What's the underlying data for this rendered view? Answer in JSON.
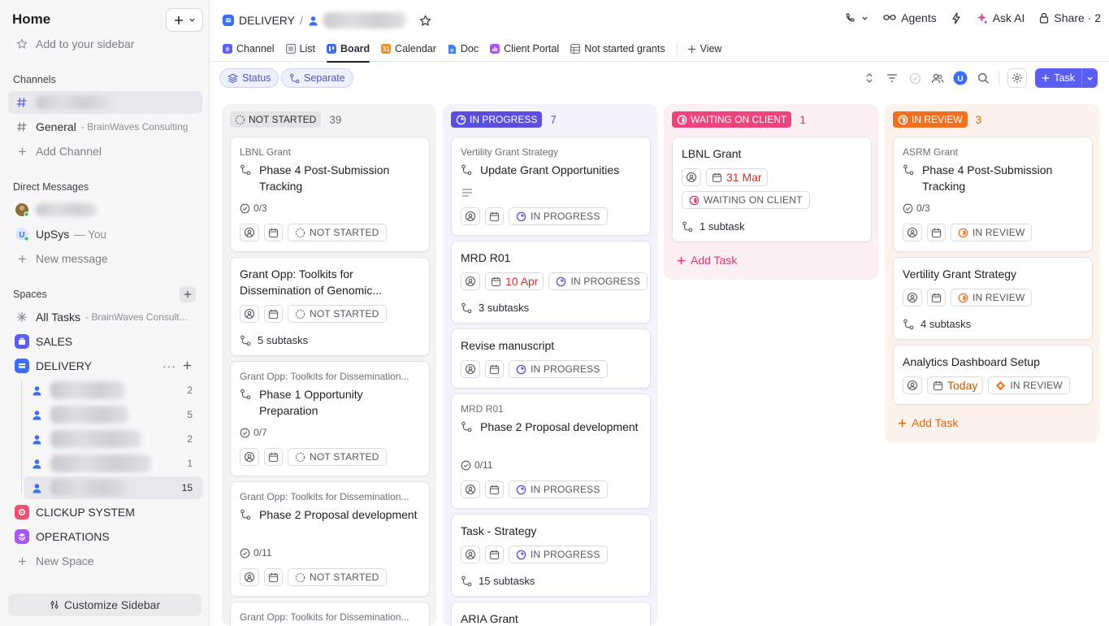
{
  "sidebar": {
    "home": "Home",
    "add_to_sidebar": "Add to your sidebar",
    "channels_title": "Channels",
    "channel_general": "General",
    "channel_general_sub": "- BrainWaves Consulting",
    "add_channel": "Add Channel",
    "dm_title": "Direct Messages",
    "dm_user": "UpSys",
    "dm_user_sub": "— You",
    "new_message": "New message",
    "spaces_title": "Spaces",
    "all_tasks": "All Tasks",
    "all_tasks_sub": "- BrainWaves Consult...",
    "space_sales": "SALES",
    "space_delivery": "DELIVERY",
    "delivery_children_counts": [
      "2",
      "5",
      "2",
      "1",
      "15"
    ],
    "space_clickup": "CLICKUP SYSTEM",
    "space_operations": "OPERATIONS",
    "new_space": "New Space",
    "customize": "Customize Sidebar"
  },
  "header": {
    "breadcrumb_space": "DELIVERY",
    "breadcrumb_sep": "/",
    "agents": "Agents",
    "ask_ai": "Ask AI",
    "share": "Share · 2",
    "views": [
      {
        "label": "Channel",
        "icon": "hash-icon",
        "color": "#5b5ef0"
      },
      {
        "label": "List",
        "icon": "list-icon",
        "color": "#6b6f76"
      },
      {
        "label": "Board",
        "icon": "board-icon",
        "color": "#3b6ef5"
      },
      {
        "label": "Calendar",
        "icon": "calendar-icon",
        "color": "#f08a24"
      },
      {
        "label": "Doc",
        "icon": "doc-icon",
        "color": "#3b82f6"
      },
      {
        "label": "Client Portal",
        "icon": "chart-icon",
        "color": "#a855f7"
      },
      {
        "label": "Not started grants",
        "icon": "table-icon",
        "color": "#6b6f76"
      }
    ],
    "add_view": "View"
  },
  "toolbar": {
    "status": "Status",
    "separate": "Separate",
    "task": "Task"
  },
  "columns": [
    {
      "status": "NOT STARTED",
      "count": "39",
      "color": "#6b6f76",
      "bg": "#f4f4f5"
    },
    {
      "status": "IN PROGRESS",
      "count": "7",
      "color": "#5b4fe0",
      "bg": "#f3f2fd"
    },
    {
      "status": "WAITING ON CLIENT",
      "count": "1",
      "color": "#e0336e",
      "bg": "#fdf0f4",
      "add": "Add Task"
    },
    {
      "status": "IN REVIEW",
      "count": "3",
      "color": "#e8630a",
      "bg": "#fef3ec",
      "add": "Add Task"
    }
  ],
  "cards": {
    "ns1": {
      "parent": "LBNL Grant",
      "title": "Phase 4 Post-Submission Tracking",
      "progress": "0/3",
      "status": "NOT STARTED"
    },
    "ns2": {
      "title": "Grant Opp: Toolkits for Dissemination of Genomic...",
      "status": "NOT STARTED",
      "subtasks": "5 subtasks"
    },
    "ns3": {
      "parent": "Grant Opp: Toolkits for Dissemination...",
      "title": "Phase 1 Opportunity Preparation",
      "progress": "0/7",
      "status": "NOT STARTED"
    },
    "ns4": {
      "parent": "Grant Opp: Toolkits for Dissemination...",
      "title": "Phase 2 Proposal development",
      "progress": "0/11",
      "status": "NOT STARTED"
    },
    "ns5": {
      "parent": "Grant Opp: Toolkits for Dissemination..."
    },
    "ip1": {
      "parent": "Vertility Grant Strategy",
      "title": "Update Grant Opportunities",
      "status": "IN PROGRESS"
    },
    "ip2": {
      "title": "MRD R01",
      "date": "10 Apr",
      "status": "IN PROGRESS",
      "subtasks": "3 subtasks"
    },
    "ip3": {
      "title": "Revise manuscript",
      "status": "IN PROGRESS"
    },
    "ip4": {
      "parent": "MRD R01",
      "title": "Phase 2 Proposal development",
      "progress": "0/11",
      "status": "IN PROGRESS"
    },
    "ip5": {
      "title": "Task - Strategy",
      "status": "IN PROGRESS",
      "subtasks": "15 subtasks"
    },
    "ip6": {
      "title": "ARIA Grant"
    },
    "wc1": {
      "title": "LBNL Grant",
      "date": "31 Mar",
      "status": "WAITING ON CLIENT",
      "subtasks": "1 subtask"
    },
    "ir1": {
      "parent": "ASRM Grant",
      "title": "Phase 4 Post-Submission Tracking",
      "progress": "0/3",
      "status": "IN REVIEW"
    },
    "ir2": {
      "title": "Vertility Grant Strategy",
      "status": "IN REVIEW",
      "subtasks": "4 subtasks"
    },
    "ir3": {
      "title": "Analytics Dashboard Setup",
      "date": "Today",
      "status": "IN REVIEW"
    }
  }
}
